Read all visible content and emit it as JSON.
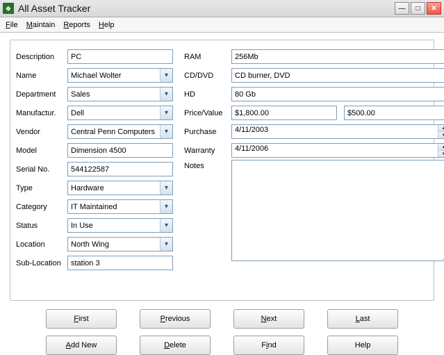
{
  "window": {
    "title": "All Asset Tracker"
  },
  "menu": {
    "file": "File",
    "maintain": "Maintain",
    "reports": "Reports",
    "help": "Help"
  },
  "labels": {
    "description": "Description",
    "name": "Name",
    "department": "Department",
    "manufacturer": "Manufactur.",
    "vendor": "Vendor",
    "model": "Model",
    "serial": "Serial No.",
    "type": "Type",
    "category": "Category",
    "status": "Status",
    "location": "Location",
    "sublocation": "Sub-Location",
    "ram": "RAM",
    "cddvd": "CD/DVD",
    "hd": "HD",
    "price": "Price/Value",
    "purchase": "Purchase",
    "warranty": "Warranty",
    "notes": "Notes"
  },
  "values": {
    "description": "PC",
    "name": "Michael Wolter",
    "department": "Sales",
    "manufacturer": "Dell",
    "vendor": "Central Penn Computers",
    "model": "Dimension 4500",
    "serial": "544122587",
    "type": "Hardware",
    "category": "IT Maintained",
    "status": "In Use",
    "location": "North Wing",
    "sublocation": "station 3",
    "ram": "256Mb",
    "cddvd": "CD burner, DVD",
    "hd": "80 Gb",
    "price1": "$1,800.00",
    "price2": "$500.00",
    "purchase": "4/11/2003",
    "warranty": "4/11/2006",
    "notes": ""
  },
  "buttons": {
    "first": "First",
    "previous": "Previous",
    "next": "Next",
    "last": "Last",
    "addnew": "Add New",
    "delete": "Delete",
    "find": "Find",
    "help": "Help"
  }
}
